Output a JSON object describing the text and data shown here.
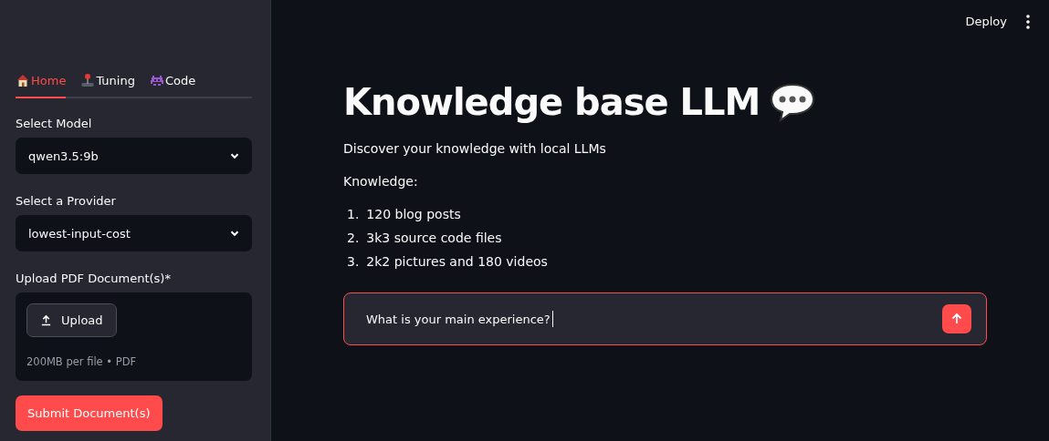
{
  "header": {
    "deploy": "Deploy"
  },
  "sidebar": {
    "tabs": [
      {
        "label": "Home",
        "selected": true
      },
      {
        "label": "Tuning",
        "selected": false
      },
      {
        "label": "Code",
        "selected": false
      }
    ],
    "model": {
      "label": "Select Model",
      "value": "qwen3.5:9b"
    },
    "provider": {
      "label": "Select a Provider",
      "value": "lowest-input-cost"
    },
    "upload": {
      "label": "Upload PDF Document(s)*",
      "button": "Upload",
      "hint": "200MB per file • PDF"
    },
    "submit": "Submit Document(s)"
  },
  "main": {
    "title": "Knowledge base LLM",
    "subtitle": "Discover your knowledge with local LLMs",
    "knowledge_label": "Knowledge:",
    "items": [
      {
        "number": "1.",
        "text": "120 blog posts"
      },
      {
        "number": "2.",
        "text": "3k3 source code files"
      },
      {
        "number": "3.",
        "text": "2k2 pictures and 180 videos"
      }
    ],
    "chat_input": {
      "value": "What is your main experience?"
    }
  }
}
